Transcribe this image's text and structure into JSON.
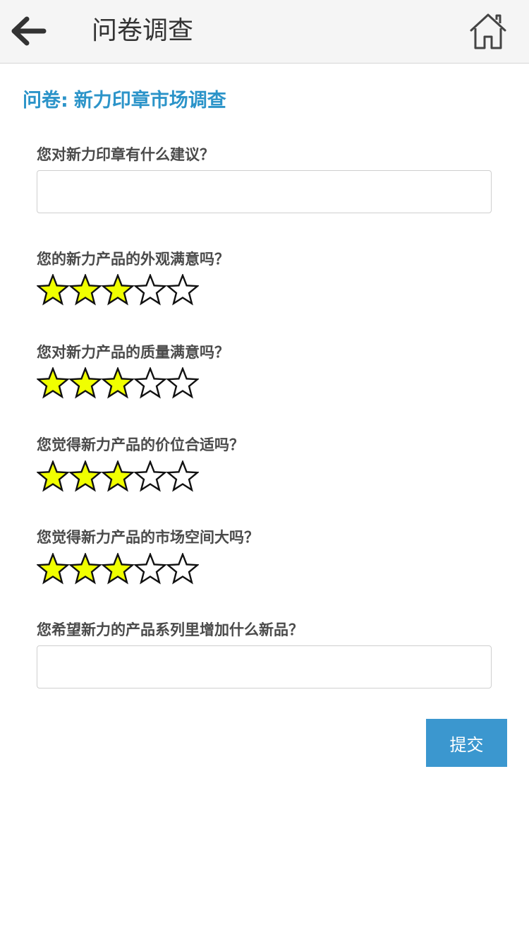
{
  "header": {
    "title": "问卷调查",
    "back_icon": "arrow-left-icon",
    "home_icon": "home-icon"
  },
  "survey": {
    "prefix": "问卷:",
    "name": "新力印章市场调查"
  },
  "questions": [
    {
      "type": "text",
      "label": "您对新力印章有什么建议？",
      "value": "",
      "placeholder": ""
    },
    {
      "type": "rating",
      "label": "您的新力产品的外观满意吗？",
      "rating": 3,
      "max": 5
    },
    {
      "type": "rating",
      "label": "您对新力产品的质量满意吗？",
      "rating": 3,
      "max": 5
    },
    {
      "type": "rating",
      "label": "您觉得新力产品的价位合适吗？",
      "rating": 3,
      "max": 5
    },
    {
      "type": "rating",
      "label": "您觉得新力产品的市场空间大吗？",
      "rating": 3,
      "max": 5
    },
    {
      "type": "text",
      "label": "您希望新力的产品系列里增加什么新品？",
      "value": "",
      "placeholder": ""
    }
  ],
  "submit_label": "提交",
  "colors": {
    "header_bg": "#f5f5f5",
    "accent": "#2c94c9",
    "button": "#3b97cf",
    "star_filled": "#f0ff00",
    "star_empty": "#ffffff"
  }
}
